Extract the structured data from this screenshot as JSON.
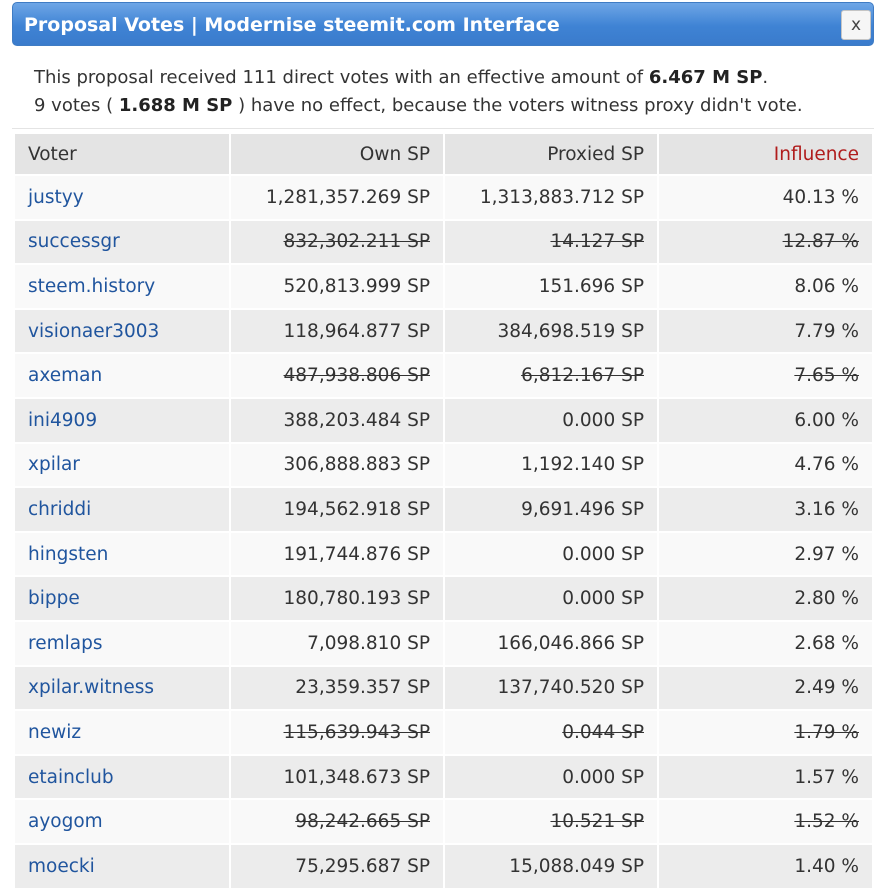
{
  "dialog": {
    "title": "Proposal Votes | Modernise steemit.com Interface",
    "close_label": "x"
  },
  "summary": {
    "line1_prefix": "This proposal received 111 direct votes with an effective amount of ",
    "line1_amount": "6.467 M SP",
    "line1_suffix": ".",
    "line2_prefix": "9 votes ( ",
    "line2_amount": "1.688 M SP",
    "line2_suffix": " ) have no effect, because the voters witness proxy didn't vote."
  },
  "table": {
    "headers": {
      "voter": "Voter",
      "own_sp": "Own SP",
      "proxied_sp": "Proxied SP",
      "influence": "Influence"
    },
    "rows": [
      {
        "voter": "justyy",
        "own_sp": "1,281,357.269 SP",
        "proxied_sp": "1,313,883.712 SP",
        "influence": "40.13 %",
        "no_effect": false
      },
      {
        "voter": "successgr",
        "own_sp": "832,302.211 SP",
        "proxied_sp": "14.127 SP",
        "influence": "12.87 %",
        "no_effect": true
      },
      {
        "voter": "steem.history",
        "own_sp": "520,813.999 SP",
        "proxied_sp": "151.696 SP",
        "influence": "8.06 %",
        "no_effect": false
      },
      {
        "voter": "visionaer3003",
        "own_sp": "118,964.877 SP",
        "proxied_sp": "384,698.519 SP",
        "influence": "7.79 %",
        "no_effect": false
      },
      {
        "voter": "axeman",
        "own_sp": "487,938.806 SP",
        "proxied_sp": "6,812.167 SP",
        "influence": "7.65 %",
        "no_effect": true
      },
      {
        "voter": "ini4909",
        "own_sp": "388,203.484 SP",
        "proxied_sp": "0.000 SP",
        "influence": "6.00 %",
        "no_effect": false
      },
      {
        "voter": "xpilar",
        "own_sp": "306,888.883 SP",
        "proxied_sp": "1,192.140 SP",
        "influence": "4.76 %",
        "no_effect": false
      },
      {
        "voter": "chriddi",
        "own_sp": "194,562.918 SP",
        "proxied_sp": "9,691.496 SP",
        "influence": "3.16 %",
        "no_effect": false
      },
      {
        "voter": "hingsten",
        "own_sp": "191,744.876 SP",
        "proxied_sp": "0.000 SP",
        "influence": "2.97 %",
        "no_effect": false
      },
      {
        "voter": "bippe",
        "own_sp": "180,780.193 SP",
        "proxied_sp": "0.000 SP",
        "influence": "2.80 %",
        "no_effect": false
      },
      {
        "voter": "remlaps",
        "own_sp": "7,098.810 SP",
        "proxied_sp": "166,046.866 SP",
        "influence": "2.68 %",
        "no_effect": false
      },
      {
        "voter": "xpilar.witness",
        "own_sp": "23,359.357 SP",
        "proxied_sp": "137,740.520 SP",
        "influence": "2.49 %",
        "no_effect": false
      },
      {
        "voter": "newiz",
        "own_sp": "115,639.943 SP",
        "proxied_sp": "0.044 SP",
        "influence": "1.79 %",
        "no_effect": true
      },
      {
        "voter": "etainclub",
        "own_sp": "101,348.673 SP",
        "proxied_sp": "0.000 SP",
        "influence": "1.57 %",
        "no_effect": false
      },
      {
        "voter": "ayogom",
        "own_sp": "98,242.665 SP",
        "proxied_sp": "10.521 SP",
        "influence": "1.52 %",
        "no_effect": true
      },
      {
        "voter": "moecki",
        "own_sp": "75,295.687 SP",
        "proxied_sp": "15,088.049 SP",
        "influence": "1.40 %",
        "no_effect": false
      }
    ]
  },
  "colors": {
    "title_bar": "#3f83d4",
    "link": "#20559e",
    "influence_header": "#b01c1c"
  }
}
